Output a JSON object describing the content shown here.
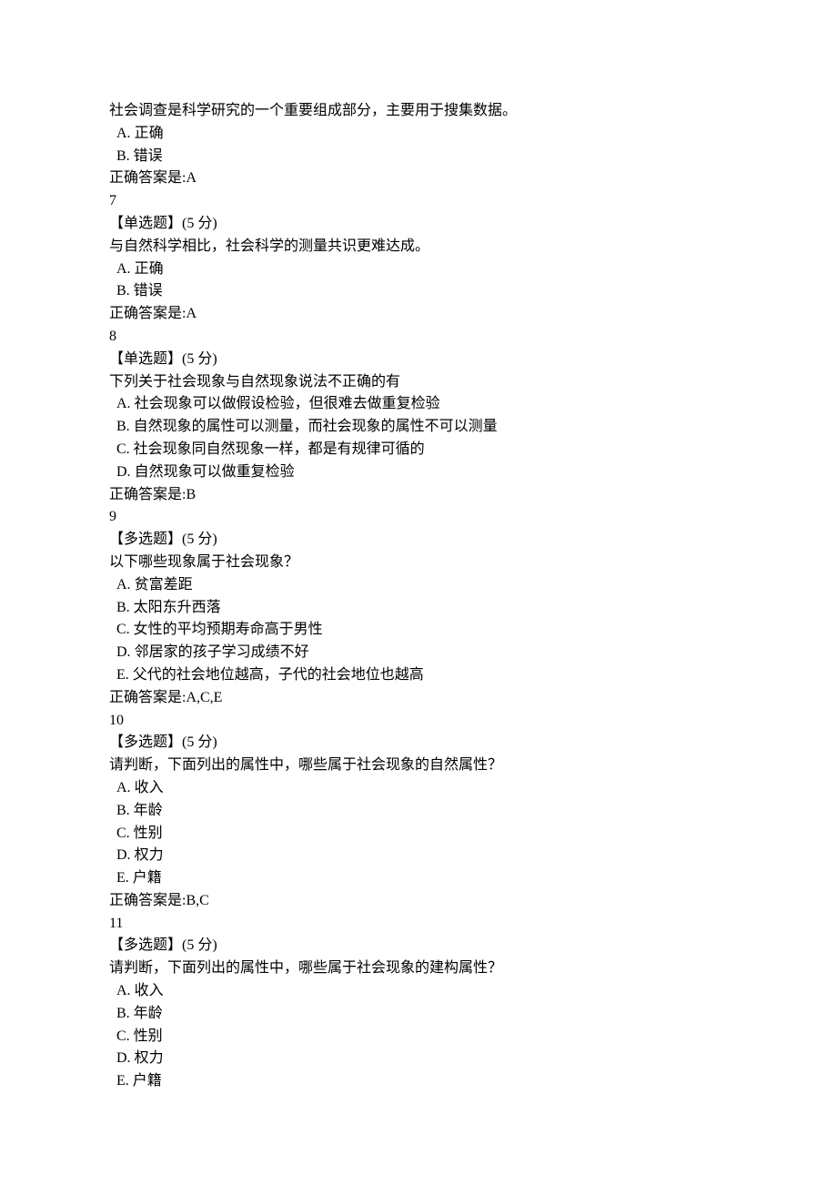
{
  "labels": {
    "answer_prefix": "正确答案是:",
    "points_suffix_before": "(",
    "points_suffix_after": " 分)",
    "points_value": "5"
  },
  "q6": {
    "stem": "社会调查是科学研究的一个重要组成部分，主要用于搜集数据。",
    "options": [
      {
        "letter": "A.",
        "text": " 正确"
      },
      {
        "letter": "B.",
        "text": " 错误"
      }
    ],
    "answer": "A"
  },
  "q7": {
    "number": "7",
    "type_label": "【单选题】",
    "stem": "与自然科学相比，社会科学的测量共识更难达成。",
    "options": [
      {
        "letter": "A.",
        "text": " 正确"
      },
      {
        "letter": "B.",
        "text": " 错误"
      }
    ],
    "answer": "A"
  },
  "q8": {
    "number": "8",
    "type_label": "【单选题】",
    "stem": "下列关于社会现象与自然现象说法不正确的有",
    "options": [
      {
        "letter": "A.",
        "text": " 社会现象可以做假设检验，但很难去做重复检验"
      },
      {
        "letter": "B.",
        "text": " 自然现象的属性可以测量，而社会现象的属性不可以测量"
      },
      {
        "letter": "C.",
        "text": " 社会现象同自然现象一样，都是有规律可循的"
      },
      {
        "letter": "D.",
        "text": " 自然现象可以做重复检验"
      }
    ],
    "answer": "B"
  },
  "q9": {
    "number": "9",
    "type_label": "【多选题】",
    "stem": "以下哪些现象属于社会现象？",
    "options": [
      {
        "letter": "A.",
        "text": " 贫富差距"
      },
      {
        "letter": "B.",
        "text": " 太阳东升西落"
      },
      {
        "letter": "C.",
        "text": " 女性的平均预期寿命高于男性"
      },
      {
        "letter": "D.",
        "text": " 邻居家的孩子学习成绩不好"
      },
      {
        "letter": "E.",
        "text": " 父代的社会地位越高，子代的社会地位也越高"
      }
    ],
    "answer": "A,C,E"
  },
  "q10": {
    "number": "10",
    "type_label": "【多选题】",
    "stem": "请判断，下面列出的属性中，哪些属于社会现象的自然属性？",
    "options": [
      {
        "letter": "A.",
        "text": " 收入"
      },
      {
        "letter": "B.",
        "text": " 年龄"
      },
      {
        "letter": "C.",
        "text": " 性别"
      },
      {
        "letter": "D.",
        "text": " 权力"
      },
      {
        "letter": "E.",
        "text": " 户籍"
      }
    ],
    "answer": "B,C"
  },
  "q11": {
    "number": "11",
    "type_label": "【多选题】",
    "stem": "请判断，下面列出的属性中，哪些属于社会现象的建构属性？",
    "options": [
      {
        "letter": "A.",
        "text": " 收入"
      },
      {
        "letter": "B.",
        "text": " 年龄"
      },
      {
        "letter": "C.",
        "text": " 性别"
      },
      {
        "letter": "D.",
        "text": " 权力"
      },
      {
        "letter": "E.",
        "text": " 户籍"
      }
    ]
  }
}
